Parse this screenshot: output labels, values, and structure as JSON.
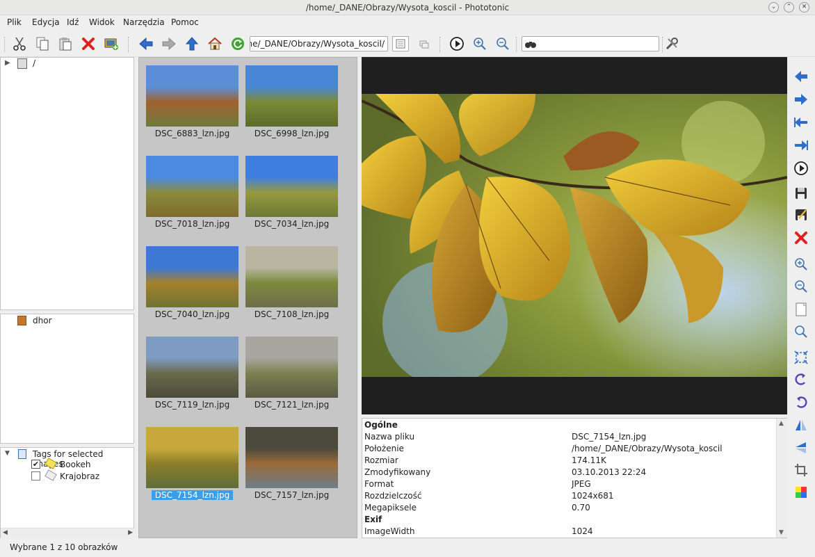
{
  "window": {
    "title": "/home/_DANE/Obrazy/Wysota_koscil - Phototonic"
  },
  "menu": [
    "Plik",
    "Edycja",
    "Idź",
    "Widok",
    "Narzędzia",
    "Pomoc"
  ],
  "toolbar": {
    "path_value": "/home/_DANE/Obrazy/Wysota_koscil",
    "search_value": "",
    "icons": [
      "cut-icon",
      "copy-icon",
      "paste-icon",
      "delete-icon",
      "add-image-icon",
      "back-arrow-icon",
      "forward-arrow-icon",
      "up-arrow-icon",
      "home-icon",
      "refresh-icon",
      "thumbnail-view-icon",
      "filter-icon",
      "slideshow-icon",
      "zoom-in-icon",
      "zoom-out-icon",
      "binoculars-icon",
      "settings-tools-icon"
    ]
  },
  "tree": {
    "root_label": "/"
  },
  "bookmarks": {
    "items": [
      "dhor"
    ]
  },
  "tags": {
    "header": "Tags for selected images",
    "items": [
      {
        "label": "Bookeh",
        "checked": true
      },
      {
        "label": "Krajobraz",
        "checked": false
      }
    ]
  },
  "thumbnails": [
    {
      "name": "DSC_6883_lzn.jpg",
      "selected": false,
      "palette": [
        "#5a8fd8",
        "#a1612e",
        "#6e7b3b"
      ]
    },
    {
      "name": "DSC_6998_lzn.jpg",
      "selected": false,
      "palette": [
        "#4a86d6",
        "#7c8a35",
        "#5b6b2a"
      ]
    },
    {
      "name": "DSC_7018_lzn.jpg",
      "selected": false,
      "palette": [
        "#4a8ae0",
        "#8b8b3c",
        "#7f6b2d"
      ]
    },
    {
      "name": "DSC_7034_lzn.jpg",
      "selected": false,
      "palette": [
        "#3f7fe0",
        "#96993f",
        "#6c7a35"
      ]
    },
    {
      "name": "DSC_7040_lzn.jpg",
      "selected": false,
      "palette": [
        "#3d78d4",
        "#a5802b",
        "#6f7433"
      ]
    },
    {
      "name": "DSC_7108_lzn.jpg",
      "selected": false,
      "palette": [
        "#b8b5a0",
        "#7c8a3e",
        "#6e6d4a"
      ]
    },
    {
      "name": "DSC_7119_lzn.jpg",
      "selected": false,
      "palette": [
        "#7e9cc2",
        "#6a6a4c",
        "#4c4a3a"
      ]
    },
    {
      "name": "DSC_7121_lzn.jpg",
      "selected": false,
      "palette": [
        "#a7a7a0",
        "#7a8050",
        "#5a5a42"
      ]
    },
    {
      "name": "DSC_7154_lzn.jpg",
      "selected": true,
      "palette": [
        "#c6a93a",
        "#8c7d2a",
        "#5e6e3a"
      ]
    },
    {
      "name": "DSC_7157_lzn.jpg",
      "selected": false,
      "palette": [
        "#4b4a3c",
        "#9a6a3a",
        "#6c7e8a"
      ]
    }
  ],
  "info": {
    "rows": [
      {
        "label": "Ogólne",
        "value": "",
        "header": true
      },
      {
        "label": "Nazwa pliku",
        "value": "DSC_7154_lzn.jpg"
      },
      {
        "label": "Położenie",
        "value": "/home/_DANE/Obrazy/Wysota_koscil"
      },
      {
        "label": "Rozmiar",
        "value": "174.11K"
      },
      {
        "label": "Zmodyfikowany",
        "value": "03.10.2013 22:24"
      },
      {
        "label": "Format",
        "value": "JPEG"
      },
      {
        "label": "Rozdzielczość",
        "value": "1024x681"
      },
      {
        "label": "Megapiksele",
        "value": "0.70"
      },
      {
        "label": "Exif",
        "value": "",
        "header": true
      },
      {
        "label": "ImageWidth",
        "value": "1024"
      }
    ]
  },
  "right_toolbar": [
    "previous-image-icon",
    "next-image-icon",
    "first-image-icon",
    "last-image-icon",
    "slideshow-icon",
    "save-icon",
    "save-as-icon",
    "delete-icon",
    "zoom-in-icon",
    "zoom-out-icon",
    "reset-zoom-icon",
    "original-size-icon",
    "fit-to-window-icon",
    "rotate-left-icon",
    "rotate-right-icon",
    "flip-horizontal-icon",
    "flip-vertical-icon",
    "crop-icon",
    "color-adjust-icon"
  ],
  "status": {
    "text": "Wybrane 1 z 10 obrazków"
  }
}
